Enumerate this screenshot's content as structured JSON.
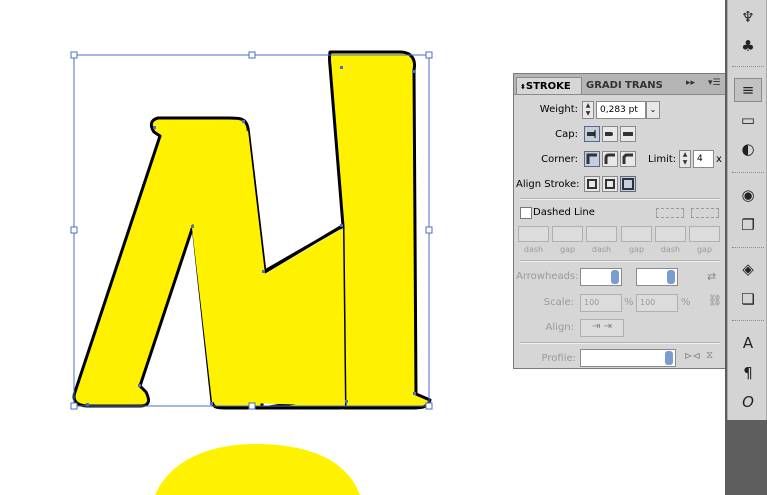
{
  "panel": {
    "tabs": [
      "STROKE",
      "GRADI",
      "TRANS"
    ],
    "menu_icons": [
      "collapse-icon",
      "panel-menu-icon"
    ],
    "weight": {
      "label": "Weight:",
      "value": "0,283 pt"
    },
    "cap": {
      "label": "Cap:"
    },
    "corner": {
      "label": "Corner:",
      "limit_label": "Limit:",
      "limit_value": "4",
      "limit_unit": "x"
    },
    "align_stroke": {
      "label": "Align Stroke:"
    },
    "dashed": {
      "label": "Dashed Line",
      "checked": false,
      "fields": [
        "dash",
        "gap",
        "dash",
        "gap",
        "dash",
        "gap"
      ]
    },
    "arrowheads": {
      "label": "Arrowheads:"
    },
    "scale": {
      "label": "Scale:",
      "value1": "100",
      "value2": "100",
      "unit": "%"
    },
    "align": {
      "label": "Align:"
    },
    "profile": {
      "label": "Profile:"
    }
  },
  "dock": {
    "icons": [
      "symbol-sprayer-icon",
      "club-icon",
      "stroke-panel-icon",
      "gradient-icon",
      "transparency-icon",
      "appearance-icon",
      "graphic-styles-icon",
      "layers-icon",
      "artboards-icon",
      "character-icon",
      "paragraph-icon",
      "opentype-icon"
    ],
    "glyphs": [
      "♆",
      "♣",
      "≡",
      "▭",
      "◐",
      "◉",
      "❐",
      "◈",
      "❏",
      "A",
      "¶",
      "O"
    ]
  },
  "colors": {
    "fill": "#fff200",
    "selection": "#4a6fc8",
    "stroke": "#000000"
  }
}
